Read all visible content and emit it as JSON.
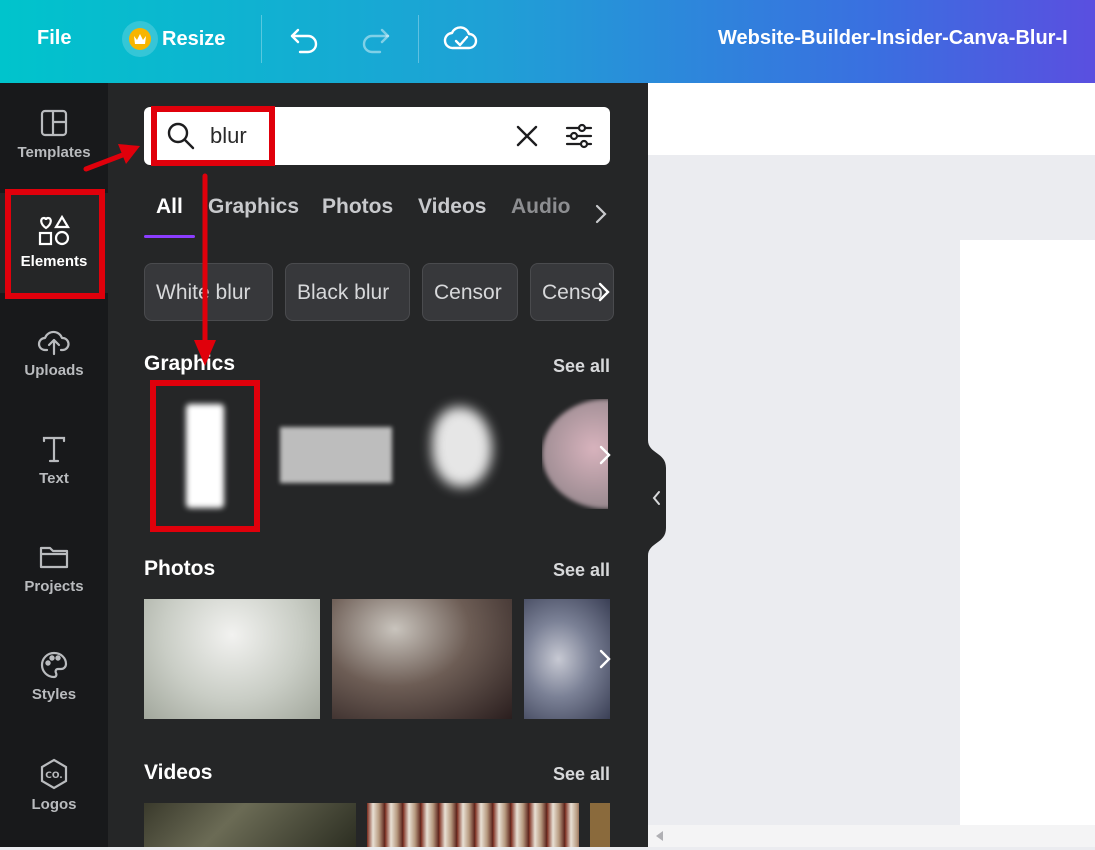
{
  "topbar": {
    "file_label": "File",
    "resize_label": "Resize",
    "document_title": "Website-Builder-Insider-Canva-Blur-I"
  },
  "rail": {
    "items": [
      {
        "label": "Templates",
        "icon": "templates-icon"
      },
      {
        "label": "Elements",
        "icon": "elements-icon",
        "active": true
      },
      {
        "label": "Uploads",
        "icon": "uploads-icon"
      },
      {
        "label": "Text",
        "icon": "text-icon"
      },
      {
        "label": "Projects",
        "icon": "projects-icon"
      },
      {
        "label": "Styles",
        "icon": "styles-icon"
      },
      {
        "label": "Logos",
        "icon": "logos-icon"
      }
    ]
  },
  "search": {
    "value": "blur"
  },
  "tabs": [
    "All",
    "Graphics",
    "Photos",
    "Videos",
    "Audio"
  ],
  "chips": [
    "White blur",
    "Black blur",
    "Censor",
    "Censo"
  ],
  "sections": {
    "graphics": {
      "title": "Graphics",
      "see_all": "See all"
    },
    "photos": {
      "title": "Photos",
      "see_all": "See all"
    },
    "videos": {
      "title": "Videos",
      "see_all": "See all"
    }
  },
  "colors": {
    "accent": "#8b3dff",
    "annotation": "#e0000b",
    "panel_bg": "#252627",
    "rail_bg": "#18191b"
  }
}
